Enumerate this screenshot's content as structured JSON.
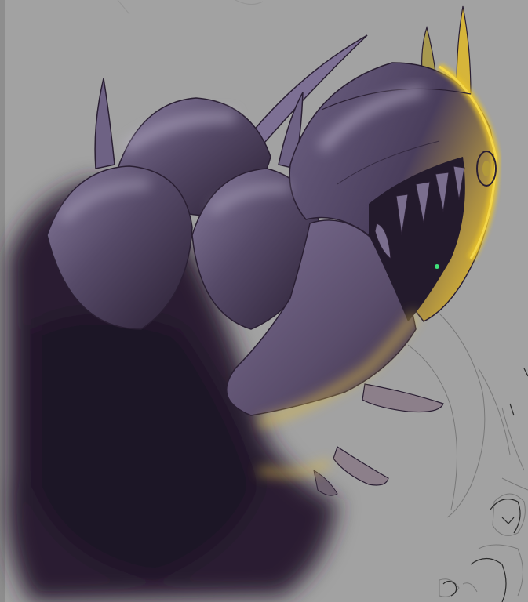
{
  "canvas": {
    "background_color": "#a2a2a2",
    "left_strip_color": "#8e8e8e"
  },
  "palette": {
    "shadow": "#2a1f33",
    "shadow_mid": "#3b2e47",
    "body": "#5a4d6b",
    "body_light": "#8a7ea0",
    "highlight": "#b8b0c8",
    "rim_glow": "#e8c32a",
    "rim_glow_soft": "#d8b84a",
    "sketch_line": "#7a7a7a",
    "eye": "#3fe07a"
  },
  "subjects": [
    {
      "name": "creature",
      "description_icon": "segmented-beast-icon"
    },
    {
      "name": "background-character-sketch",
      "description_icon": "sketch-figure-icon"
    }
  ]
}
